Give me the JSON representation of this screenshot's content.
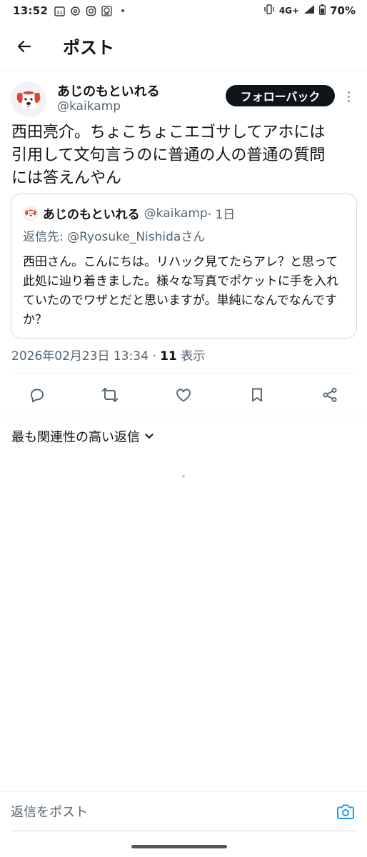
{
  "status_bar": {
    "time": "13:52",
    "calendar_date": "31",
    "network": "4G+",
    "battery": "70%"
  },
  "header": {
    "title": "ポスト"
  },
  "post": {
    "author_name": "あじのもといれる",
    "author_handle": "@kaikamp",
    "follow_label": "フォローバック",
    "text": "西田亮介。ちょこちょこエゴサしてアホには\n引用して文句言うのに普通の人の普通の質問\nには答えんやん",
    "timestamp": "2026年02月23日 13:34 · ",
    "views_count": "11",
    "views_label": " 表示"
  },
  "quote": {
    "author_name": "あじのもといれる",
    "author_handle": "@kaikamp",
    "time": " · 1日",
    "reply_prefix": "返信先: ",
    "reply_to": "@Ryosuke_Nishidaさん",
    "text": "西田さん。こんにちは。リハック見てたらアレ？と思って此処に辿り着きました。様々な写真でポケットに手を入れていたのでワザとだと思いますが。単純になんでなんですか？"
  },
  "actions": {
    "icons": [
      "reply-icon",
      "retweet-icon",
      "like-icon",
      "bookmark-icon",
      "share-icon"
    ]
  },
  "sort": {
    "label": "最も関連性の高い返信"
  },
  "reply_bar": {
    "placeholder": "返信をポスト"
  },
  "colors": {
    "text_primary": "#0f1419",
    "text_secondary": "#536471",
    "accent_blue": "#1d9bf0",
    "border": "#cfd9de"
  }
}
